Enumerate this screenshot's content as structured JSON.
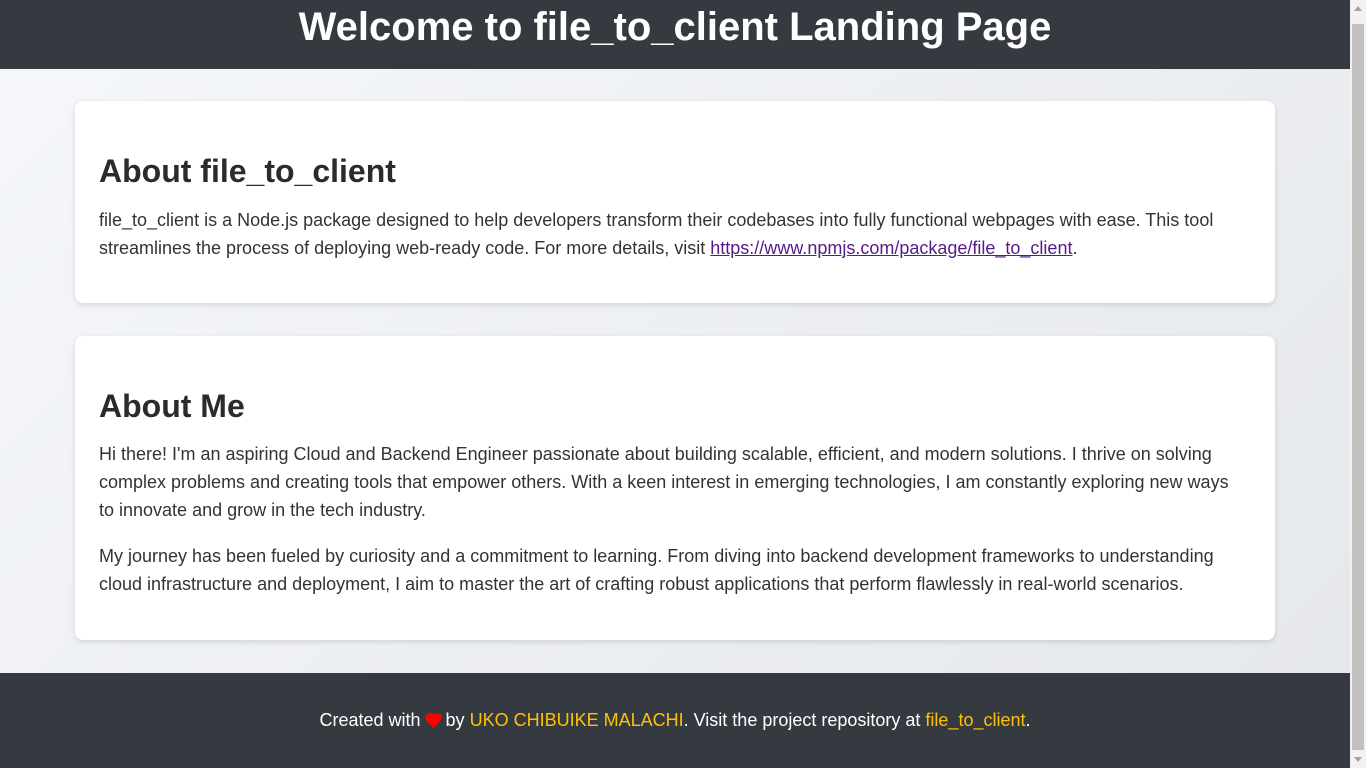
{
  "header": {
    "title": "Welcome to file_to_client Landing Page"
  },
  "about_package": {
    "heading": "About file_to_client",
    "text_before_link": "file_to_client is a Node.js package designed to help developers transform their codebases into fully functional webpages with ease. This tool streamlines the process of deploying web-ready code. For more details, visit ",
    "link_text": "https://www.npmjs.com/package/file_to_client",
    "text_after_link": "."
  },
  "about_me": {
    "heading": "About Me",
    "paragraph_1": "Hi there! I'm an aspiring Cloud and Backend Engineer passionate about building scalable, efficient, and modern solutions. I thrive on solving complex problems and creating tools that empower others. With a keen interest in emerging technologies, I am constantly exploring new ways to innovate and grow in the tech industry.",
    "paragraph_2": "My journey has been fueled by curiosity and a commitment to learning. From diving into backend development frameworks to understanding cloud infrastructure and deployment, I aim to master the art of crafting robust applications that perform flawlessly in real-world scenarios."
  },
  "footer": {
    "created_with": "Created with",
    "heart_icon": "heart-icon",
    "by": "by",
    "author": "UKO CHIBUIKE MALACHI",
    "visit_text": ". Visit the project repository at",
    "repo_link": "file_to_client",
    "end": "."
  },
  "colors": {
    "header_bg": "#343a40",
    "footer_bg": "#343a40",
    "accent": "#ffc107",
    "heart": "#ff0000",
    "link": "#551a8b"
  }
}
